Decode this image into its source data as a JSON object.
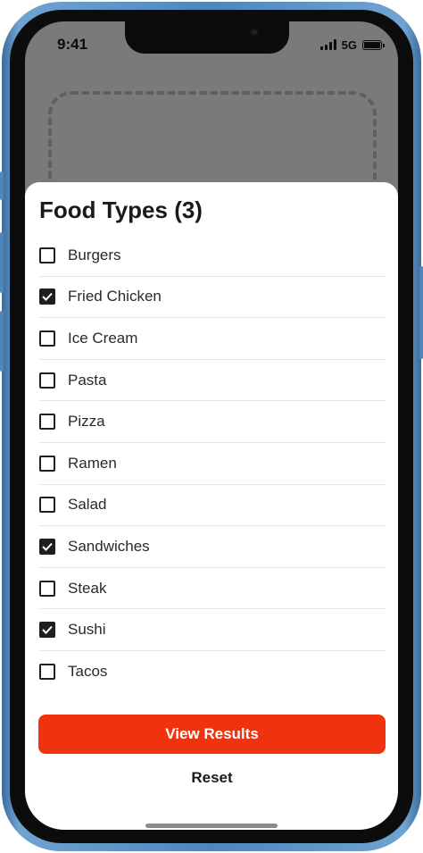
{
  "status_bar": {
    "time": "9:41",
    "network": "5G",
    "signal_icon": "cellular-signal-icon",
    "battery_icon": "battery-icon"
  },
  "sheet": {
    "title": "Food Types (3)",
    "items": [
      {
        "label": "Burgers",
        "checked": false
      },
      {
        "label": "Fried Chicken",
        "checked": true
      },
      {
        "label": "Ice Cream",
        "checked": false
      },
      {
        "label": "Pasta",
        "checked": false
      },
      {
        "label": "Pizza",
        "checked": false
      },
      {
        "label": "Ramen",
        "checked": false
      },
      {
        "label": "Salad",
        "checked": false
      },
      {
        "label": "Sandwiches",
        "checked": true
      },
      {
        "label": "Steak",
        "checked": false
      },
      {
        "label": "Sushi",
        "checked": true
      },
      {
        "label": "Tacos",
        "checked": false
      }
    ],
    "primary_button": "View Results",
    "secondary_button": "Reset"
  },
  "colors": {
    "accent": "#f0320f",
    "checkbox": "#1f1f1f",
    "overlay": "#7a7a7a",
    "frame": "#4f86bb"
  }
}
